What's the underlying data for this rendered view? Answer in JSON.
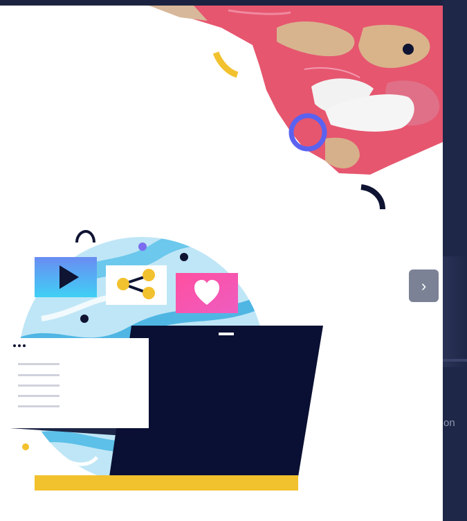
{
  "carousel": {
    "next_icon": "chevron-right-icon",
    "next_glyph": "›",
    "side_peek_text": "on"
  },
  "colors": {
    "navy": "#1e2747",
    "tissue_pink": "#e6566f",
    "ring_blue": "#5b62f0",
    "accent_yellow": "#f2c12e",
    "heart_pink": "#f257a9",
    "globe_blue": "#7fd0ee",
    "laptop_dark": "#0a1033"
  }
}
